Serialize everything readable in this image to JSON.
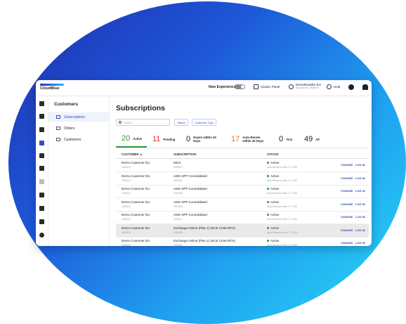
{
  "brand": {
    "logo_text": "CloudBlue"
  },
  "topbar": {
    "new_experience_label": "New Experience",
    "classic_panel_label": "Classic Panel",
    "account_name": "DemoReseller EU",
    "account_id": "Account ID: 1000273",
    "help_label": "Help"
  },
  "subnav": {
    "title": "Customers",
    "items": [
      {
        "label": "Subscriptions"
      },
      {
        "label": "Orders"
      },
      {
        "label": "Customers"
      }
    ]
  },
  "main": {
    "title": "Subscriptions",
    "search_placeholder": "Search",
    "filter_status": "Status",
    "filter_customer_type": "Customer Type"
  },
  "stats": [
    {
      "count": "20",
      "label": "Active",
      "color": "#2d9b3a"
    },
    {
      "count": "11",
      "label": "Pending",
      "color": "#d93b3b"
    },
    {
      "count": "0",
      "label": "Expire within 30 Days",
      "color": "#222222"
    },
    {
      "count": "17",
      "label": "Auto-Renew within 30 Days",
      "color": "#e07b2a"
    },
    {
      "count": "0",
      "label": "Trial",
      "color": "#222222"
    },
    {
      "count": "49",
      "label": "All",
      "color": "#222222"
    }
  ],
  "table": {
    "headers": {
      "customer": "CUSTOMER ▲",
      "subscription": "SUBSCRIPTION",
      "status": "STATUS"
    },
    "change_label": "CHANGE",
    "login_label": "LOG IN",
    "rows": [
      {
        "customer": "Demo Customer EU",
        "customer_id": "1000012",
        "subscription": "MCG",
        "subscription_id": "1000027",
        "status": "Active",
        "status_detail": "Auto-Renew on Mar 17, 2023"
      },
      {
        "customer": "Demo Customer EU",
        "customer_id": "1000012",
        "subscription": "AWS SPP Consolidated",
        "subscription_id": "1000044",
        "status": "Active",
        "status_detail": "Auto-Renew on Mar 17, 2023"
      },
      {
        "customer": "Demo Customer EU",
        "customer_id": "1000012",
        "subscription": "AWS SPP Consolidated",
        "subscription_id": "1000045",
        "status": "Active",
        "status_detail": "Auto-Renew on Mar 17, 2023"
      },
      {
        "customer": "Demo Customer EU",
        "customer_id": "1000012",
        "subscription": "AWS SPP Consolidated",
        "subscription_id": "1000046",
        "status": "Active",
        "status_detail": "Auto-Renew on Mar 17, 2023"
      },
      {
        "customer": "Demo Customer EU",
        "customer_id": "1000012",
        "subscription": "AWS SPP Consolidated",
        "subscription_id": "1000047",
        "status": "Active",
        "status_detail": "Auto-Renew on Mar 17, 2023"
      },
      {
        "customer": "Demo Customer EU",
        "customer_id": "1000012",
        "subscription": "Exchange Online (Plan 1) (NCE COM MTH)",
        "subscription_id": "1000050",
        "status": "Active",
        "status_detail": "Auto-Renew on Mar 17, 2023"
      },
      {
        "customer": "Demo Customer EU",
        "customer_id": "1000012",
        "subscription": "Exchange Online (Plan 1) (NCE COM MTH)",
        "subscription_id": "1000051",
        "status": "Active",
        "status_detail": "Auto-Renew on Mar 17, 2023"
      }
    ]
  }
}
